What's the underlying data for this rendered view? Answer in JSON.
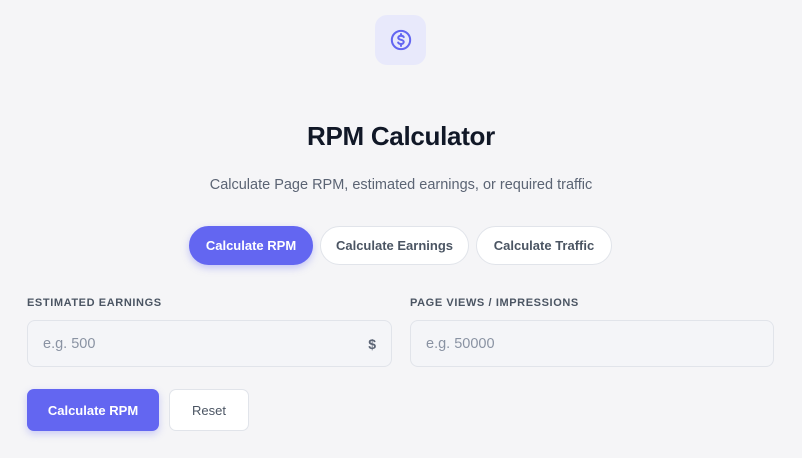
{
  "header": {
    "icon": "dollar-circle-icon",
    "title": "RPM Calculator",
    "subtitle": "Calculate Page RPM, estimated earnings, or required traffic"
  },
  "tabs": [
    {
      "label": "Calculate RPM",
      "active": true
    },
    {
      "label": "Calculate Earnings",
      "active": false
    },
    {
      "label": "Calculate Traffic",
      "active": false
    }
  ],
  "form": {
    "earnings": {
      "label": "ESTIMATED EARNINGS",
      "placeholder": "e.g. 500",
      "value": "",
      "suffix": "$"
    },
    "pageviews": {
      "label": "PAGE VIEWS / IMPRESSIONS",
      "placeholder": "e.g. 50000",
      "value": ""
    }
  },
  "actions": {
    "calculate_label": "Calculate RPM",
    "reset_label": "Reset"
  },
  "colors": {
    "accent": "#6366f1",
    "icon_bg": "#e8e9fb",
    "page_bg": "#f5f5f7"
  }
}
